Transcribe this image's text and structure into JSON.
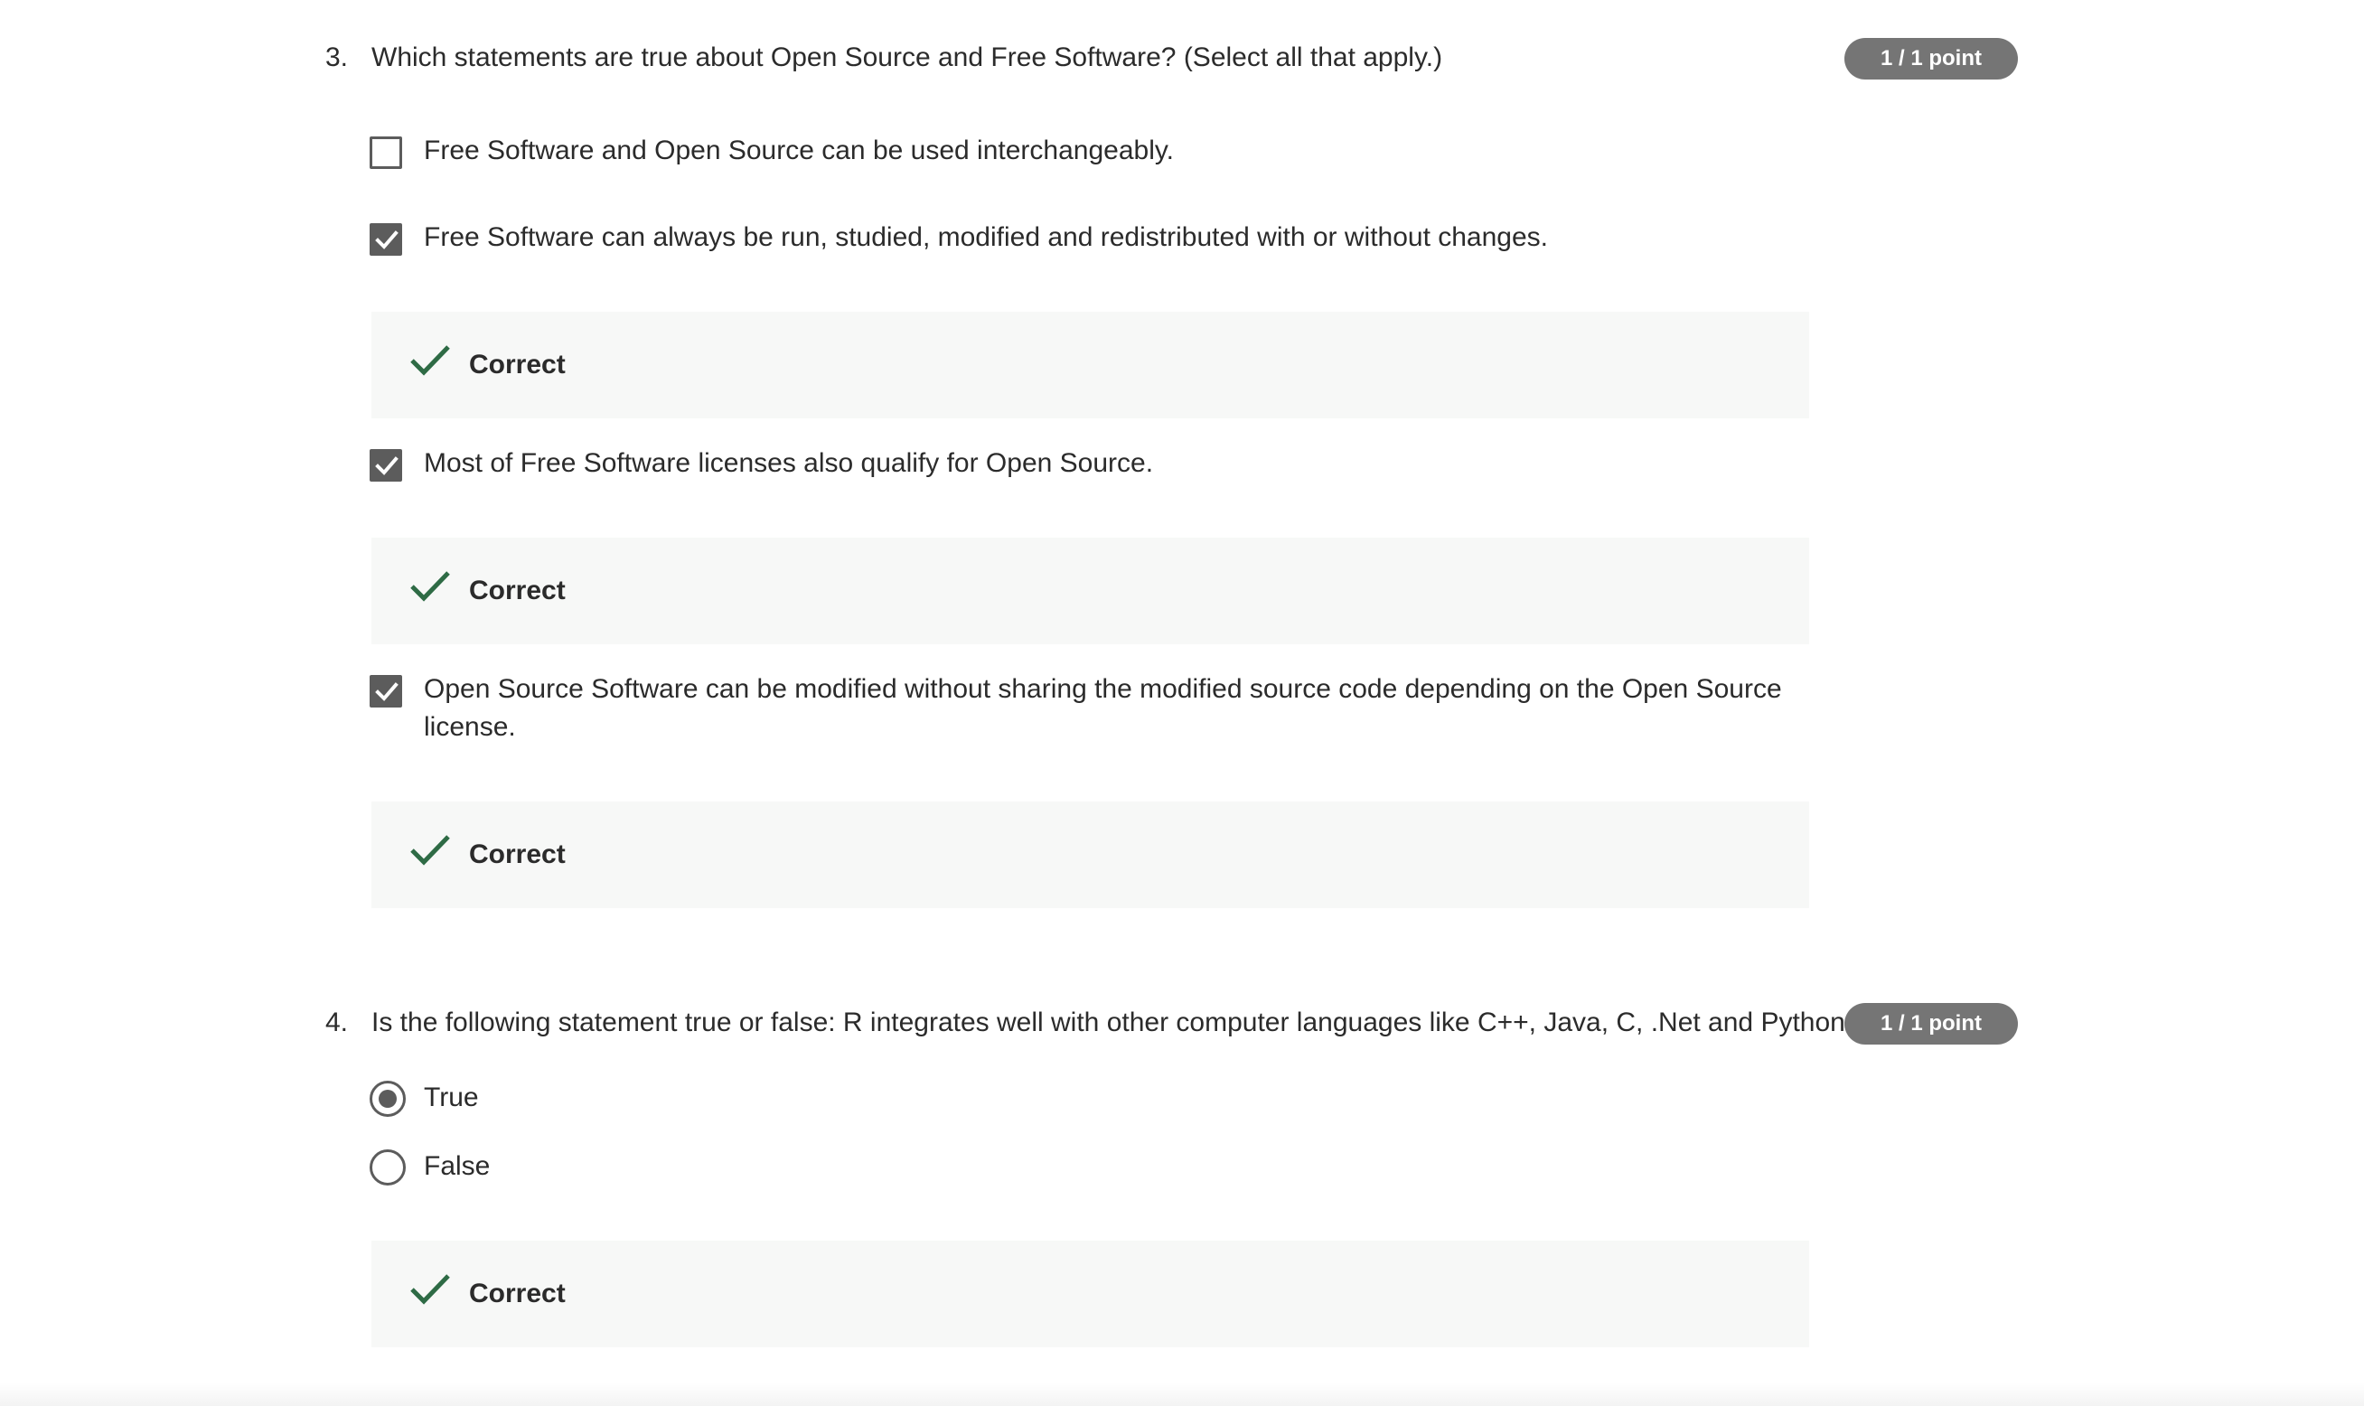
{
  "questions": [
    {
      "number": "3.",
      "text": "Which statements are true about Open Source and Free Software? (Select all that apply.)",
      "score": "1 / 1 point",
      "type": "checkbox",
      "options": [
        {
          "label": "Free Software and Open Source can be used interchangeably.",
          "checked": false
        },
        {
          "label": "Free Software can always be run, studied, modified and redistributed with or without changes.",
          "checked": true,
          "feedback": "Correct"
        },
        {
          "label": "Most of Free Software licenses also qualify for Open Source.",
          "checked": true,
          "feedback": "Correct"
        },
        {
          "label_line1": "Open Source Software can be modified without sharing the modified source code depending on the Open Source",
          "label_line2": "license.",
          "checked": true,
          "feedback": "Correct"
        }
      ]
    },
    {
      "number": "4.",
      "text": "Is the following statement true or false: R integrates well with other computer languages like C++, Java, C, .Net and Python.",
      "score": "1 / 1 point",
      "type": "radio",
      "options": [
        {
          "label": "True",
          "selected": true
        },
        {
          "label": "False",
          "selected": false
        }
      ],
      "feedback": "Correct"
    }
  ],
  "colors": {
    "badge_bg": "#757575",
    "feedback_bg": "#f7f8f7",
    "check_green": "#2e6b45",
    "control_gray": "#5c5c5c"
  },
  "icons": {
    "feedback": "checkmark-icon",
    "checkbox_checked": "checkbox-checked-icon",
    "checkbox_unchecked": "checkbox-unchecked-icon",
    "radio_selected": "radio-selected-icon",
    "radio_unselected": "radio-unselected-icon"
  }
}
